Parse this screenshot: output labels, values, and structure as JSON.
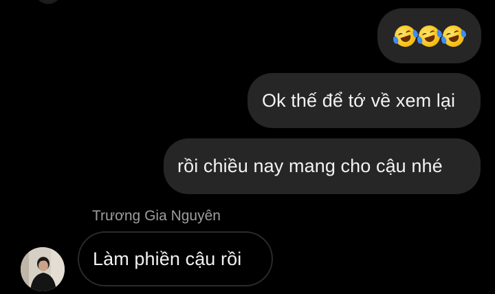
{
  "conversation": {
    "messages": [
      {
        "direction": "outgoing",
        "type": "emoji",
        "emoji_names": [
          "rolling-on-floor-laughing-icon",
          "rolling-on-floor-laughing-icon",
          "rolling-on-floor-laughing-icon"
        ]
      },
      {
        "direction": "outgoing",
        "type": "text",
        "text": "Ok thế để tớ về xem lại"
      },
      {
        "direction": "outgoing",
        "type": "text",
        "text": "rồi chiều nay mang cho cậu nhé"
      },
      {
        "direction": "incoming",
        "type": "text",
        "sender": "Trương Gia Nguyên",
        "text": "Làm phiền cậu rồi"
      }
    ]
  },
  "colors": {
    "background": "#000000",
    "outgoing_bubble": "#262626",
    "incoming_bubble_border": "#2b2b2b",
    "text": "#f2f2f2",
    "sender_name": "#9e9e9e"
  }
}
